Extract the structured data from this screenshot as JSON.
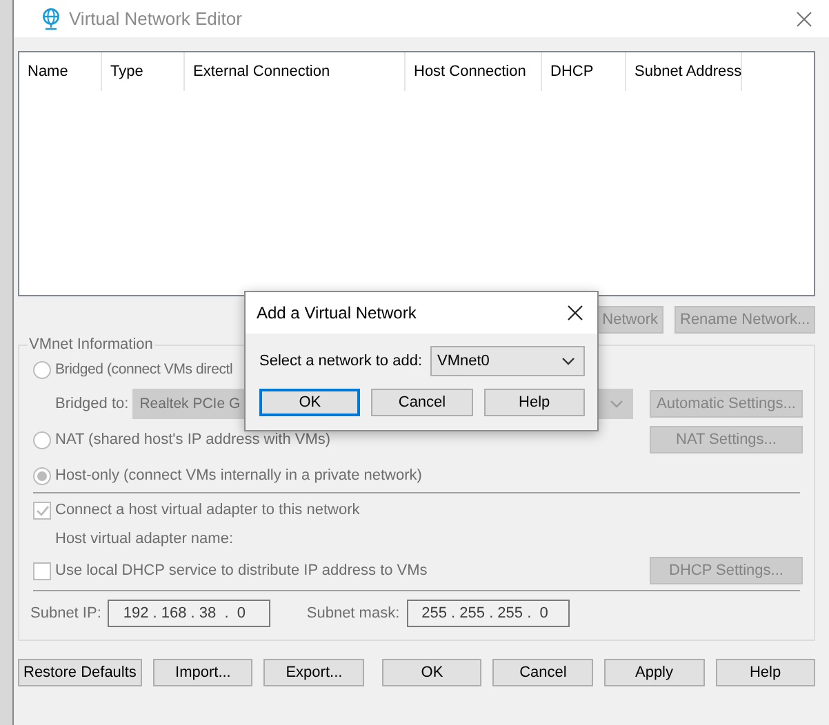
{
  "window": {
    "title": "Virtual Network Editor"
  },
  "table": {
    "columns": [
      "Name",
      "Type",
      "External Connection",
      "Host Connection",
      "DHCP",
      "Subnet Address"
    ]
  },
  "network_buttons": [
    {
      "label": "Network",
      "disabled": true
    },
    {
      "label": "Rename Network...",
      "disabled": true
    }
  ],
  "vmnet_info": {
    "title": "VMnet Information",
    "disabled": true,
    "modes": [
      {
        "label": "Bridged (connect VMs directl",
        "selected": false
      },
      {
        "label": "NAT (shared host's IP address with VMs)",
        "selected": false
      },
      {
        "label": "Host-only (connect VMs internally in a private network)",
        "selected": true
      }
    ],
    "bridged_to": {
      "label": "Bridged to:",
      "value": "Realtek PCIe G"
    },
    "automatic_settings": "Automatic Settings...",
    "nat_settings": "NAT Settings...",
    "host_adapter": {
      "label": "Connect a host virtual adapter to this network",
      "checked": true
    },
    "adapter_name_label": "Host virtual adapter name:",
    "dhcp": {
      "label": "Use local DHCP service to distribute IP address to VMs",
      "checked": false
    },
    "dhcp_settings": "DHCP Settings...",
    "subnet_ip": {
      "label": "Subnet IP:",
      "value": "192 . 168 . 38  .  0"
    },
    "subnet_mask": {
      "label": "Subnet mask:",
      "value": "255 . 255 . 255 .  0"
    }
  },
  "footer_buttons": [
    "Restore Defaults",
    "Import...",
    "Export...",
    "OK",
    "Cancel",
    "Apply",
    "Help"
  ],
  "dialog": {
    "title": "Add a Virtual Network",
    "field_label": "Select a network to add:",
    "value": "VMnet0",
    "buttons": [
      {
        "label": "OK",
        "default": true
      },
      {
        "label": "Cancel",
        "default": false
      },
      {
        "label": "Help",
        "default": false
      }
    ]
  }
}
